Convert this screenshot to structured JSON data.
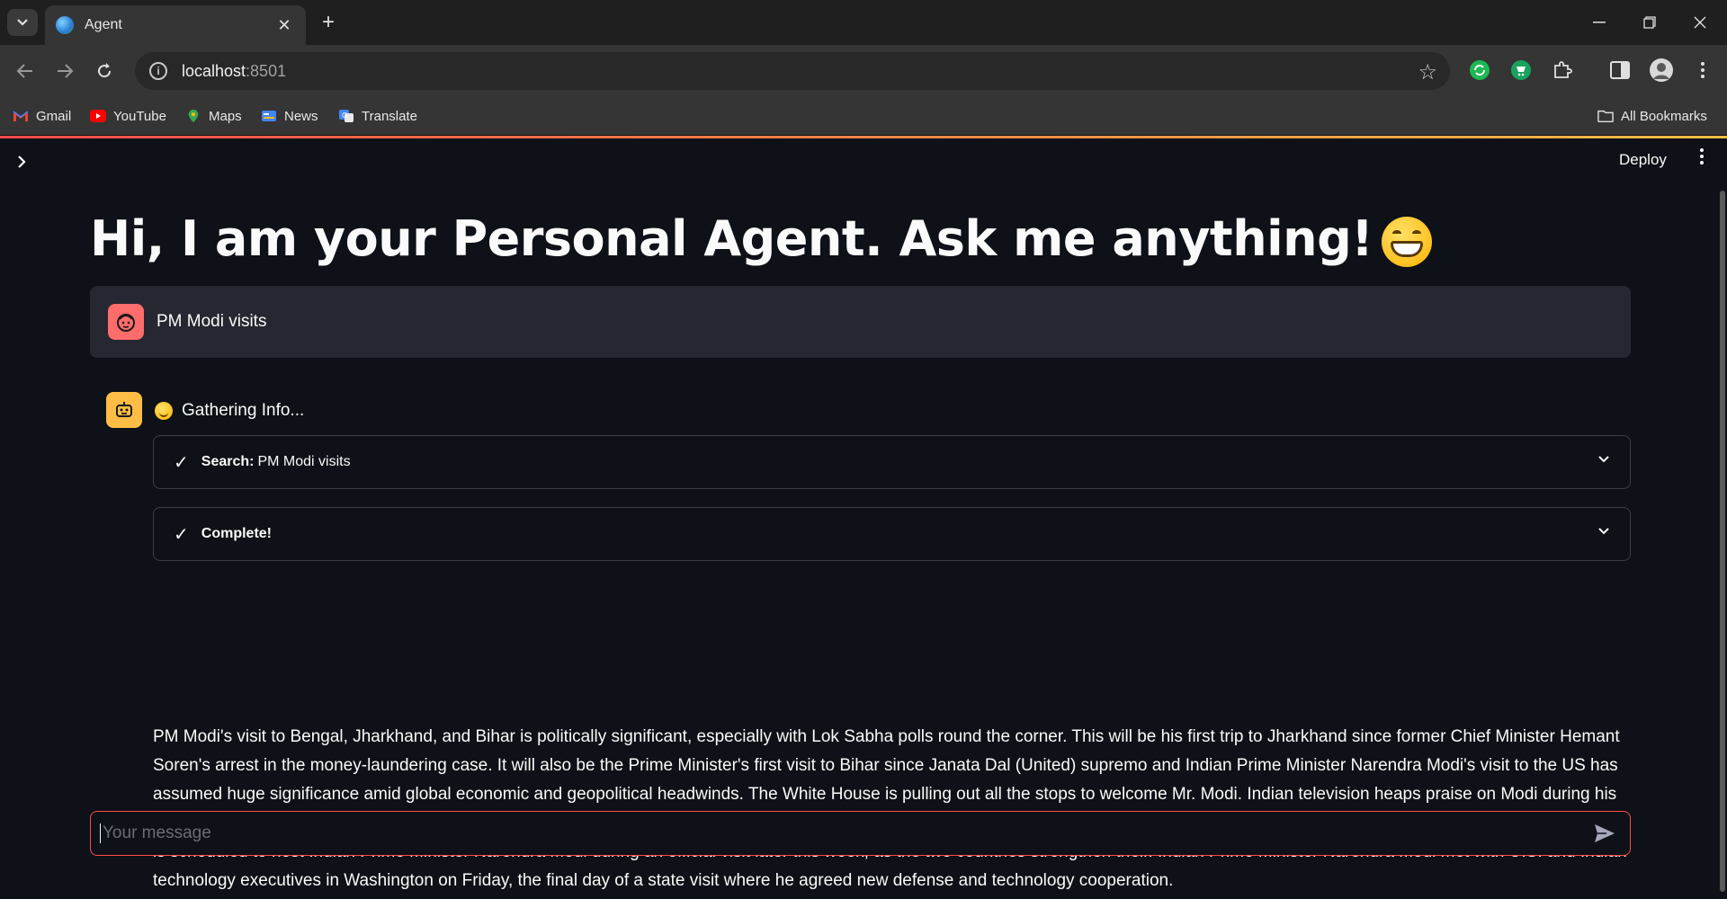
{
  "browser": {
    "tab_title": "Agent",
    "url_host": "localhost",
    "url_port": ":8501",
    "bookmarks": [
      "Gmail",
      "YouTube",
      "Maps",
      "News",
      "Translate"
    ],
    "all_bookmarks": "All Bookmarks"
  },
  "app": {
    "deploy_label": "Deploy",
    "title": "Hi, I am your Personal Agent. Ask me anything!",
    "title_emoji": "grinning-face",
    "user_message": "PM Modi visits",
    "status": "Gathering Info...",
    "expanders": [
      {
        "label": "Search:",
        "value": "PM Modi visits"
      },
      {
        "label": "Complete!",
        "value": ""
      }
    ],
    "answer": "PM Modi's visit to Bengal, Jharkhand, and Bihar is politically significant, especially with Lok Sabha polls round the corner. This will be his first trip to Jharkhand since former Chief Minister Hemant Soren's arrest in the money-laundering case. It will also be the Prime Minister's first visit to Bihar since Janata Dal (United) supremo and Indian Prime Minister Narendra Modi's visit to the US has assumed huge significance amid global economic and geopolitical headwinds. The White House is pulling out all the stops to welcome Mr. Modi. Indian television heaps praise on Modi during his trip. Prime Minister Narendra Modi's visit to the United States came Doug Mills/The New York Times. \"Super King of Diplomacy,\" read the. The administration of United States President Joe Biden is scheduled to host Indian Prime Minister Narendra Modi during an official visit later this week, as the two countries strengthen their. Indian Prime Minister Narendra Modi met with U.S. and Indian technology executives in Washington on Friday, the final day of a state visit where he agreed new defense and technology cooperation.",
    "input_placeholder": "Your message"
  },
  "colors": {
    "background": "#0e1117",
    "accent": "#ff4b4b",
    "user_avatar": "#ff6c6c",
    "bot_avatar": "#ffbd45",
    "message_bg": "#262730"
  }
}
